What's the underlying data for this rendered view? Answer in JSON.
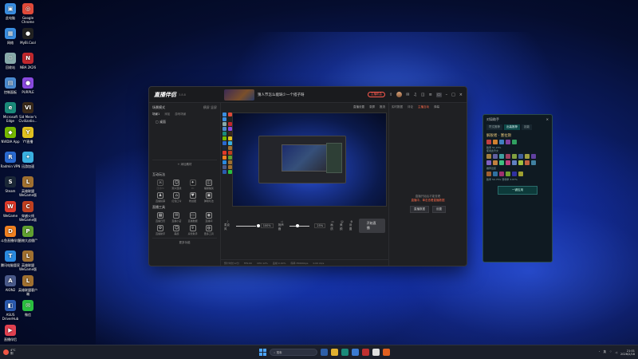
{
  "desktop": {
    "icons": [
      {
        "label": "此电脑",
        "color": "#3a8de0",
        "glyph": "▣"
      },
      {
        "label": "Google Chrome",
        "color": "#e04a3a",
        "glyph": "◎"
      },
      {
        "label": "网络",
        "color": "#3a8de0",
        "glyph": "▦"
      },
      {
        "label": "MyBi.Cool",
        "color": "#222",
        "glyph": "●"
      },
      {
        "label": "回收站",
        "color": "#8aa",
        "glyph": "♲"
      },
      {
        "label": "NBA 2K26",
        "color": "#c0272d",
        "glyph": "N"
      },
      {
        "label": "控制面板",
        "color": "#4a8ad0",
        "glyph": "▤"
      },
      {
        "label": "PURPLE",
        "color": "#8a4ae0",
        "glyph": "●"
      },
      {
        "label": "Microsoft Edge",
        "color": "#1a8a7a",
        "glyph": "e"
      },
      {
        "label": "Sid Meier's Civilizatio...",
        "color": "#3a2a1a",
        "glyph": "VI"
      },
      {
        "label": "NVIDIA App",
        "color": "#76b900",
        "glyph": "◆"
      },
      {
        "label": "YY直播",
        "color": "#e0c020",
        "glyph": "Y"
      },
      {
        "label": "Radmin VPN",
        "color": "#2a6ad0",
        "glyph": "R"
      },
      {
        "label": "迅游加速",
        "color": "#3ab0e0",
        "glyph": "✦"
      },
      {
        "label": "Steam",
        "color": "#1b2838",
        "glyph": "S"
      },
      {
        "label": "英雄联盟WeGame版",
        "color": "#a07030",
        "glyph": "L"
      },
      {
        "label": "WeGame",
        "color": "#e03a2a",
        "glyph": "W"
      },
      {
        "label": "穿越火线WeGame版",
        "color": "#c04020",
        "glyph": "C"
      },
      {
        "label": "斗鱼直播伴侣",
        "color": "#f08020",
        "glyph": "D"
      },
      {
        "label": "植物大战僵尸",
        "color": "#60a030",
        "glyph": "P"
      },
      {
        "label": "腾讯电脑管家",
        "color": "#2a8ae0",
        "glyph": "T"
      },
      {
        "label": "英雄联盟WeGame版",
        "color": "#a07030",
        "glyph": "L"
      },
      {
        "label": "AION2",
        "color": "#4a5a8a",
        "glyph": "A"
      },
      {
        "label": "英雄联盟客户端",
        "color": "#a07030",
        "glyph": "L"
      },
      {
        "label": "ASUS DriverHub",
        "color": "#2a5ab0",
        "glyph": "◧"
      },
      {
        "label": "微信",
        "color": "#2ac040",
        "glyph": "✉"
      },
      {
        "label": "直播伴侣",
        "color": "#e04050",
        "glyph": "▶"
      }
    ]
  },
  "app": {
    "logo": "直播伴侣",
    "version": "3.8.8",
    "live_title": "猜人节怎么能缺少一个搭子呀",
    "live_sub": "",
    "topbar": {
      "tag": "主播机会",
      "share": "分享"
    },
    "left": {
      "section_title": "场景模式",
      "section_right_a": "横屏",
      "section_right_b": "竖屏",
      "subtabs": [
        "场景1",
        "添加",
        "游戏场景"
      ],
      "scene_item": "桌面",
      "add_source": "添加素材",
      "interaction_title": "互动玩法",
      "interaction_tools": [
        {
          "label": "连线PK",
          "glyph": "⚔",
          "dim": true
        },
        {
          "label": "观众连线",
          "glyph": "☺",
          "dim": false
        },
        {
          "label": "PK",
          "glyph": "✦",
          "dim": true
        },
        {
          "label": "福袋抽奖",
          "glyph": "◫",
          "dim": false
        },
        {
          "label": "直播投票",
          "glyph": "♟",
          "dim": false
        },
        {
          "label": "红包口令",
          "glyph": "⌂",
          "dim": false
        },
        {
          "label": "粉丝团",
          "glyph": "♥",
          "dim": false
        },
        {
          "label": "弹幕玩法",
          "glyph": "▣",
          "dim": false
        }
      ],
      "live_tools_title": "直播工具",
      "live_tools": [
        {
          "label": "直播日历",
          "glyph": "▦"
        },
        {
          "label": "直播小店",
          "glyph": "✉"
        },
        {
          "label": "直播数据",
          "glyph": "▭"
        },
        {
          "label": "直播间",
          "glyph": "◉"
        },
        {
          "label": "直播助手",
          "glyph": "⚙"
        },
        {
          "label": "美颜",
          "glyph": "☺"
        },
        {
          "label": "房管助手",
          "glyph": "⌾"
        },
        {
          "label": "更多工具",
          "glyph": "◍"
        }
      ],
      "more": "更多功能"
    },
    "center": {
      "top_actions": [
        "直播设置",
        "录屏",
        "推流"
      ],
      "mic_label": "麦克风",
      "mic_pct": "100%",
      "speaker_label": "扬声器",
      "speaker_pct": "25%",
      "bottom_icons": [
        "画质",
        "美颜",
        "设置"
      ],
      "start_button": "开始直播",
      "status": [
        "预计时长12分",
        "FPS:60",
        "CPU:12%",
        "丢帧:0.00%",
        "码率:3566Kbps",
        "0.00 kb/s"
      ]
    },
    "right": {
      "tabs": [
        "实时数据",
        "评论",
        "主播互动",
        "弹幕"
      ],
      "empty_line1": "直播开始后才能查看",
      "empty_line2": "直播中，单击查看直播数据",
      "btn_a": "直播数据",
      "btn_b": "设置"
    }
  },
  "widget": {
    "title": "对局助手",
    "tabs": [
      "符文推荐",
      "出装推荐",
      "技能"
    ],
    "champ_name": "解脱者 · 塞拉斯",
    "line1": "胜率 51.23%",
    "line2": "使用此符文",
    "line3": "推荐出装",
    "play": "一键应用",
    "footer_a": "胜率 50.75%",
    "footer_b": "登场率 3.87%"
  },
  "taskbar": {
    "weather_temp": "4°C",
    "weather_desc": "阴",
    "search_placeholder": "搜索",
    "time": "21:01",
    "date": "2026/2/18",
    "lang": "英"
  },
  "colors": {
    "accent": "#ff5a4e",
    "widget_teal": "#0d4a4a"
  }
}
